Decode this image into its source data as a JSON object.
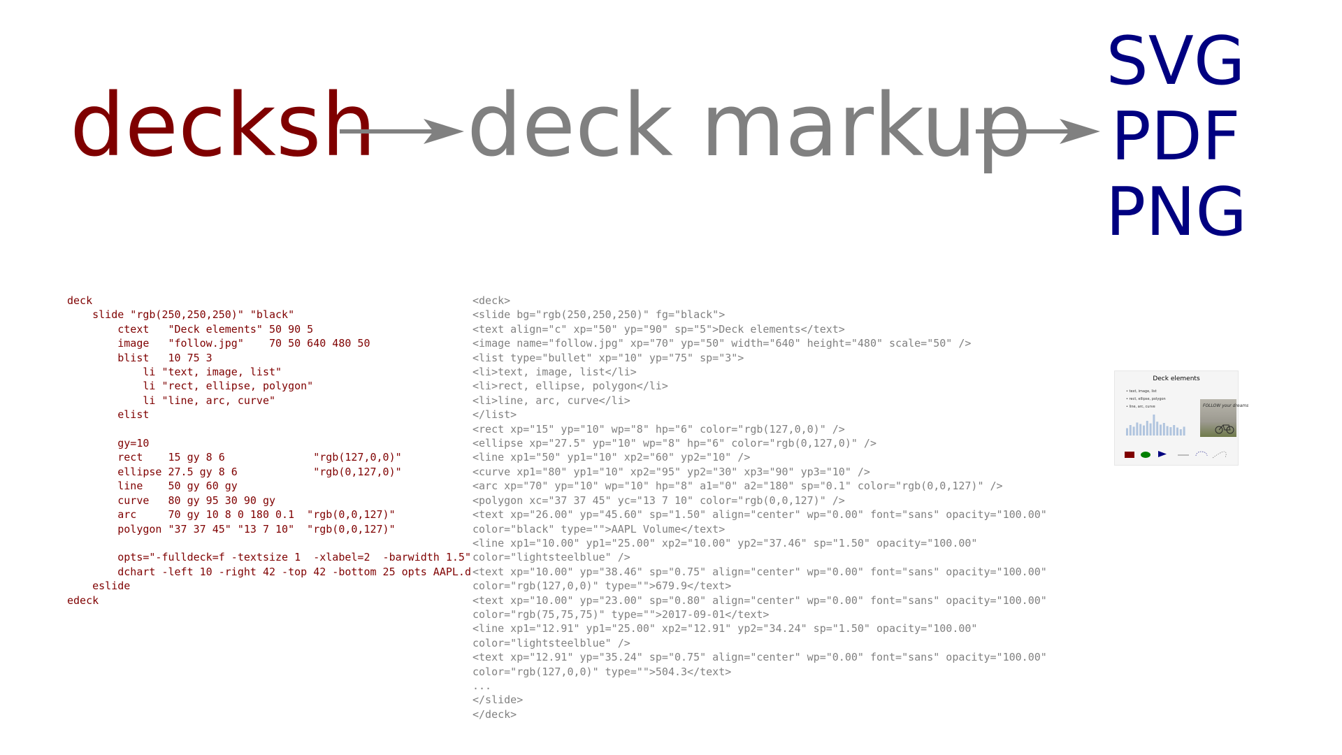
{
  "headline": {
    "source": "decksh",
    "intermediate": "deck markup",
    "outputs": [
      "SVG",
      "PDF",
      "PNG"
    ]
  },
  "decksh_code": [
    "deck",
    "    slide \"rgb(250,250,250)\" \"black\"",
    "        ctext   \"Deck elements\" 50 90 5",
    "        image   \"follow.jpg\"    70 50 640 480 50",
    "        blist   10 75 3",
    "            li \"text, image, list\"",
    "            li \"rect, ellipse, polygon\"",
    "            li \"line, arc, curve\"",
    "        elist",
    "",
    "        gy=10",
    "        rect    15 gy 8 6              \"rgb(127,0,0)\"",
    "        ellipse 27.5 gy 8 6            \"rgb(0,127,0)\"",
    "        line    50 gy 60 gy",
    "        curve   80 gy 95 30 90 gy",
    "        arc     70 gy 10 8 0 180 0.1  \"rgb(0,0,127)\"",
    "        polygon \"37 37 45\" \"13 7 10\"  \"rgb(0,0,127)\"",
    "",
    "        opts=\"-fulldeck=f -textsize 1  -xlabel=2  -barwidth 1.5\"",
    "        dchart -left 10 -right 42 -top 42 -bottom 25 opts AAPL.d",
    "    eslide",
    "edeck"
  ],
  "markup_code": [
    "<deck>",
    "<slide bg=\"rgb(250,250,250)\" fg=\"black\">",
    "<text align=\"c\" xp=\"50\" yp=\"90\" sp=\"5\">Deck elements</text>",
    "<image name=\"follow.jpg\" xp=\"70\" yp=\"50\" width=\"640\" height=\"480\" scale=\"50\" />",
    "<list type=\"bullet\" xp=\"10\" yp=\"75\" sp=\"3\">",
    "<li>text, image, list</li>",
    "<li>rect, ellipse, polygon</li>",
    "<li>line, arc, curve</li>",
    "</list>",
    "<rect xp=\"15\" yp=\"10\" wp=\"8\" hp=\"6\" color=\"rgb(127,0,0)\" />",
    "<ellipse xp=\"27.5\" yp=\"10\" wp=\"8\" hp=\"6\" color=\"rgb(0,127,0)\" />",
    "<line xp1=\"50\" yp1=\"10\" xp2=\"60\" yp2=\"10\" />",
    "<curve xp1=\"80\" yp1=\"10\" xp2=\"95\" yp2=\"30\" xp3=\"90\" yp3=\"10\" />",
    "<arc xp=\"70\" yp=\"10\" wp=\"10\" hp=\"8\" a1=\"0\" a2=\"180\" sp=\"0.1\" color=\"rgb(0,0,127)\" />",
    "<polygon xc=\"37 37 45\" yc=\"13 7 10\" color=\"rgb(0,0,127)\" />",
    "<text xp=\"26.00\" yp=\"45.60\" sp=\"1.50\" align=\"center\" wp=\"0.00\" font=\"sans\" opacity=\"100.00\"",
    "color=\"black\" type=\"\">AAPL Volume</text>",
    "<line xp1=\"10.00\" yp1=\"25.00\" xp2=\"10.00\" yp2=\"37.46\" sp=\"1.50\" opacity=\"100.00\"",
    "color=\"lightsteelblue\" />",
    "<text xp=\"10.00\" yp=\"38.46\" sp=\"0.75\" align=\"center\" wp=\"0.00\" font=\"sans\" opacity=\"100.00\"",
    "color=\"rgb(127,0,0)\" type=\"\">679.9</text>",
    "<text xp=\"10.00\" yp=\"23.00\" sp=\"0.80\" align=\"center\" wp=\"0.00\" font=\"sans\" opacity=\"100.00\"",
    "color=\"rgb(75,75,75)\" type=\"\">2017-09-01</text>",
    "<line xp1=\"12.91\" yp1=\"25.00\" xp2=\"12.91\" yp2=\"34.24\" sp=\"1.50\" opacity=\"100.00\"",
    "color=\"lightsteelblue\" />",
    "<text xp=\"12.91\" yp=\"35.24\" sp=\"0.75\" align=\"center\" wp=\"0.00\" font=\"sans\" opacity=\"100.00\"",
    "color=\"rgb(127,0,0)\" type=\"\">504.3</text>",
    "...",
    "</slide>",
    "</deck>"
  ],
  "thumbnail": {
    "title": "Deck elements",
    "list": [
      "text, image, list",
      "rect, ellipse, polygon",
      "line, arc, curve"
    ],
    "photo_caption": "FOLLOW your dreams",
    "bar_values": [
      0.35,
      0.5,
      0.42,
      0.62,
      0.55,
      0.48,
      0.7,
      0.58,
      1.0,
      0.66,
      0.52,
      0.6,
      0.45,
      0.4,
      0.5,
      0.38,
      0.3,
      0.42
    ],
    "colors": {
      "source": "#7f0000",
      "intermediate": "#808080",
      "outputs": "#000080",
      "rect": "#7f0000",
      "ellipse": "#007f00",
      "polygon": "#00007f",
      "bars": "#b0c4de"
    }
  }
}
